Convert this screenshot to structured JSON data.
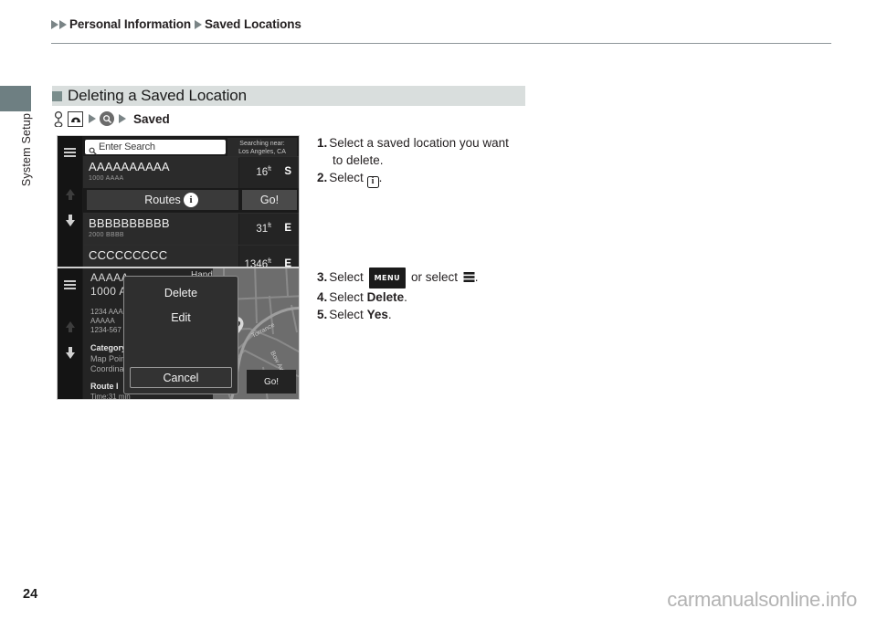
{
  "breadcrumb": {
    "item1": "Personal Information",
    "item2": "Saved Locations"
  },
  "side_tab": {
    "label": "System Setup"
  },
  "section": {
    "title": "Deleting a Saved Location",
    "nav_path": {
      "steering_icon": "steering-wheel-icon",
      "home_icon": "home-icon",
      "search_icon": "magnifier-icon",
      "final_label": "Saved"
    }
  },
  "screenshot1": {
    "name": "saved-locations-list-screen",
    "hamburger_icon": "hamburger-icon",
    "scroll_up_icon": "arrow-up-icon",
    "scroll_down_icon": "arrow-down-icon",
    "search": {
      "placeholder": "Enter Search",
      "icon": "magnifier-icon"
    },
    "searching_near": {
      "label": "Searching near:",
      "value": "Los Angeles, CA"
    },
    "rows": [
      {
        "name": "AAAAAAAAAA",
        "address": "1000 AAAA",
        "distance": "16",
        "unit": "ft",
        "direction": "S"
      },
      {
        "name": "BBBBBBBBBB",
        "address": "2000 BBBB",
        "distance": "31",
        "unit": "ft",
        "direction": "E"
      },
      {
        "name": "CCCCCCCCC",
        "address": "",
        "distance": "1346",
        "unit": "ft",
        "direction": "E"
      }
    ],
    "action_bar": {
      "routes_label": "Routes",
      "info_label": "i",
      "go_label": "Go!"
    }
  },
  "screenshot2": {
    "name": "saved-location-detail-menu-screen",
    "hamburger_icon": "hamburger-icon",
    "scroll_up_icon": "arrow-up-icon",
    "scroll_down_icon": "arrow-down-icon",
    "detail": {
      "title": "AAAAA",
      "subtitle": "1000 A",
      "header_partial": "Hand",
      "address_lines": "1234 AAA\nAAAAA\n1234-567",
      "category_label": "Category",
      "category_value": "Map Point",
      "coordinates_label": "Coordinates",
      "route_info_label": "Route I",
      "route_info_value": "Time:31 min"
    },
    "map": {
      "go_label": "Go!",
      "pin_icon": "heart-pin-icon",
      "street1": "Torrance",
      "street2": "Bow Ave"
    },
    "dialog": {
      "delete_label": "Delete",
      "edit_label": "Edit",
      "cancel_label": "Cancel"
    }
  },
  "instructions": {
    "group1": [
      {
        "num": "1.",
        "text": "Select a saved location you want",
        "text2": "to delete."
      },
      {
        "num": "2.",
        "text": "Select",
        "icon": "info-circle-icon",
        "after": "."
      }
    ],
    "group2": [
      {
        "num": "3.",
        "pre": "Select",
        "menu_button": "MENU",
        "mid": "or select",
        "icon": "list-menu-icon",
        "after": "."
      },
      {
        "num": "4.",
        "pre": "Select",
        "bold": "Delete",
        "after": "."
      },
      {
        "num": "5.",
        "pre": "Select",
        "bold": "Yes",
        "after": "."
      }
    ]
  },
  "footer": {
    "page_number": "24",
    "watermark": "carmanualsonline.info"
  }
}
